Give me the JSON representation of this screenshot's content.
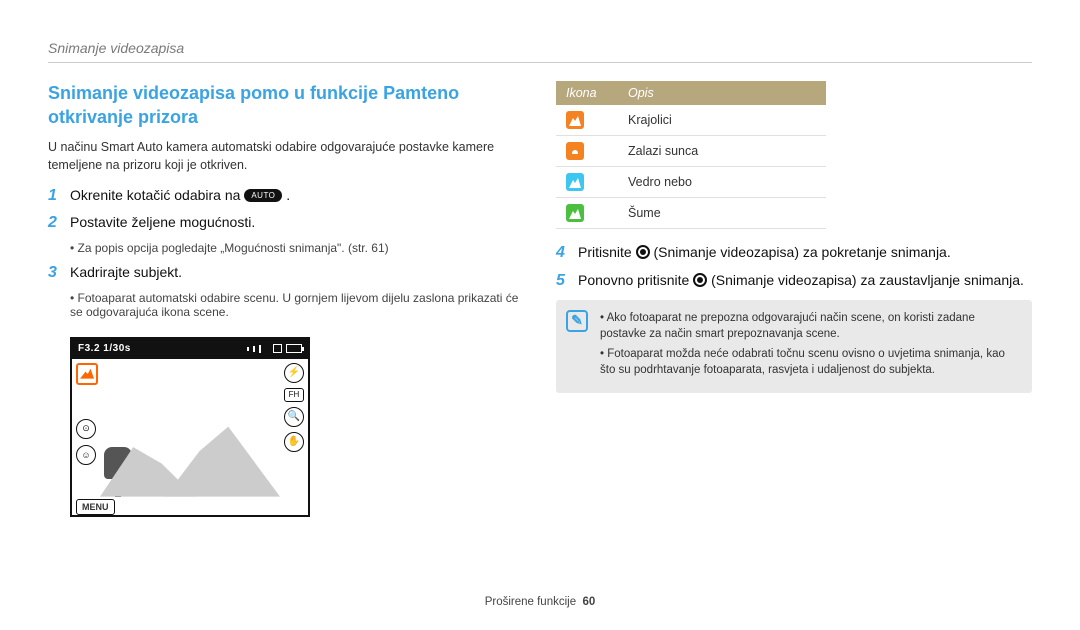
{
  "running_header": "Snimanje videozapisa",
  "title": "Snimanje videozapisa pomo u funkcije Pamteno otkrivanje prizora",
  "intro": "U načinu Smart Auto kamera automatski odabire odgovarajuće postavke kamere temeljene na prizoru koji je otkriven.",
  "steps": {
    "s1": {
      "num": "1",
      "text_a": "Okrenite kotačić odabira na ",
      "text_b": " ."
    },
    "s2": {
      "num": "2",
      "text": "Postavite željene mogućnosti.",
      "sub": "Za popis opcija pogledajte „Mogućnosti snimanja\". (str. 61)"
    },
    "s3": {
      "num": "3",
      "text": "Kadrirajte subjekt.",
      "sub": "Fotoaparat automatski odabire scenu. U gornjem lijevom dijelu zaslona prikazati će se odgovarajuća ikona scene."
    },
    "s4": {
      "num": "4",
      "text_a": "Pritisnite ",
      "text_b": " (Snimanje videozapisa) za pokretanje snimanja."
    },
    "s5": {
      "num": "5",
      "text_a": "Ponovno pritisnite ",
      "text_b": " (Snimanje videozapisa) za zaustavljanje snimanja."
    }
  },
  "auto_label": "AUTO",
  "viewfinder": {
    "exposure": "F3.2  1/30s",
    "menu": "MENU"
  },
  "table": {
    "h1": "Ikona",
    "h2": "Opis",
    "rows": [
      {
        "label": "Krajolici"
      },
      {
        "label": "Zalazi sunca"
      },
      {
        "label": "Vedro nebo"
      },
      {
        "label": "Šume"
      }
    ]
  },
  "infobox": {
    "i1": "Ako fotoaparat ne prepozna odgovarajući način scene, on koristi zadane postavke za način smart prepoznavanja scene.",
    "i2": "Fotoaparat možda neće odabrati točnu scenu ovisno o uvjetima snimanja, kao što su podrhtavanje fotoaparata, rasvjeta i udaljenost do subjekta."
  },
  "footer": {
    "section": "Proširene funkcije",
    "page": "60"
  }
}
